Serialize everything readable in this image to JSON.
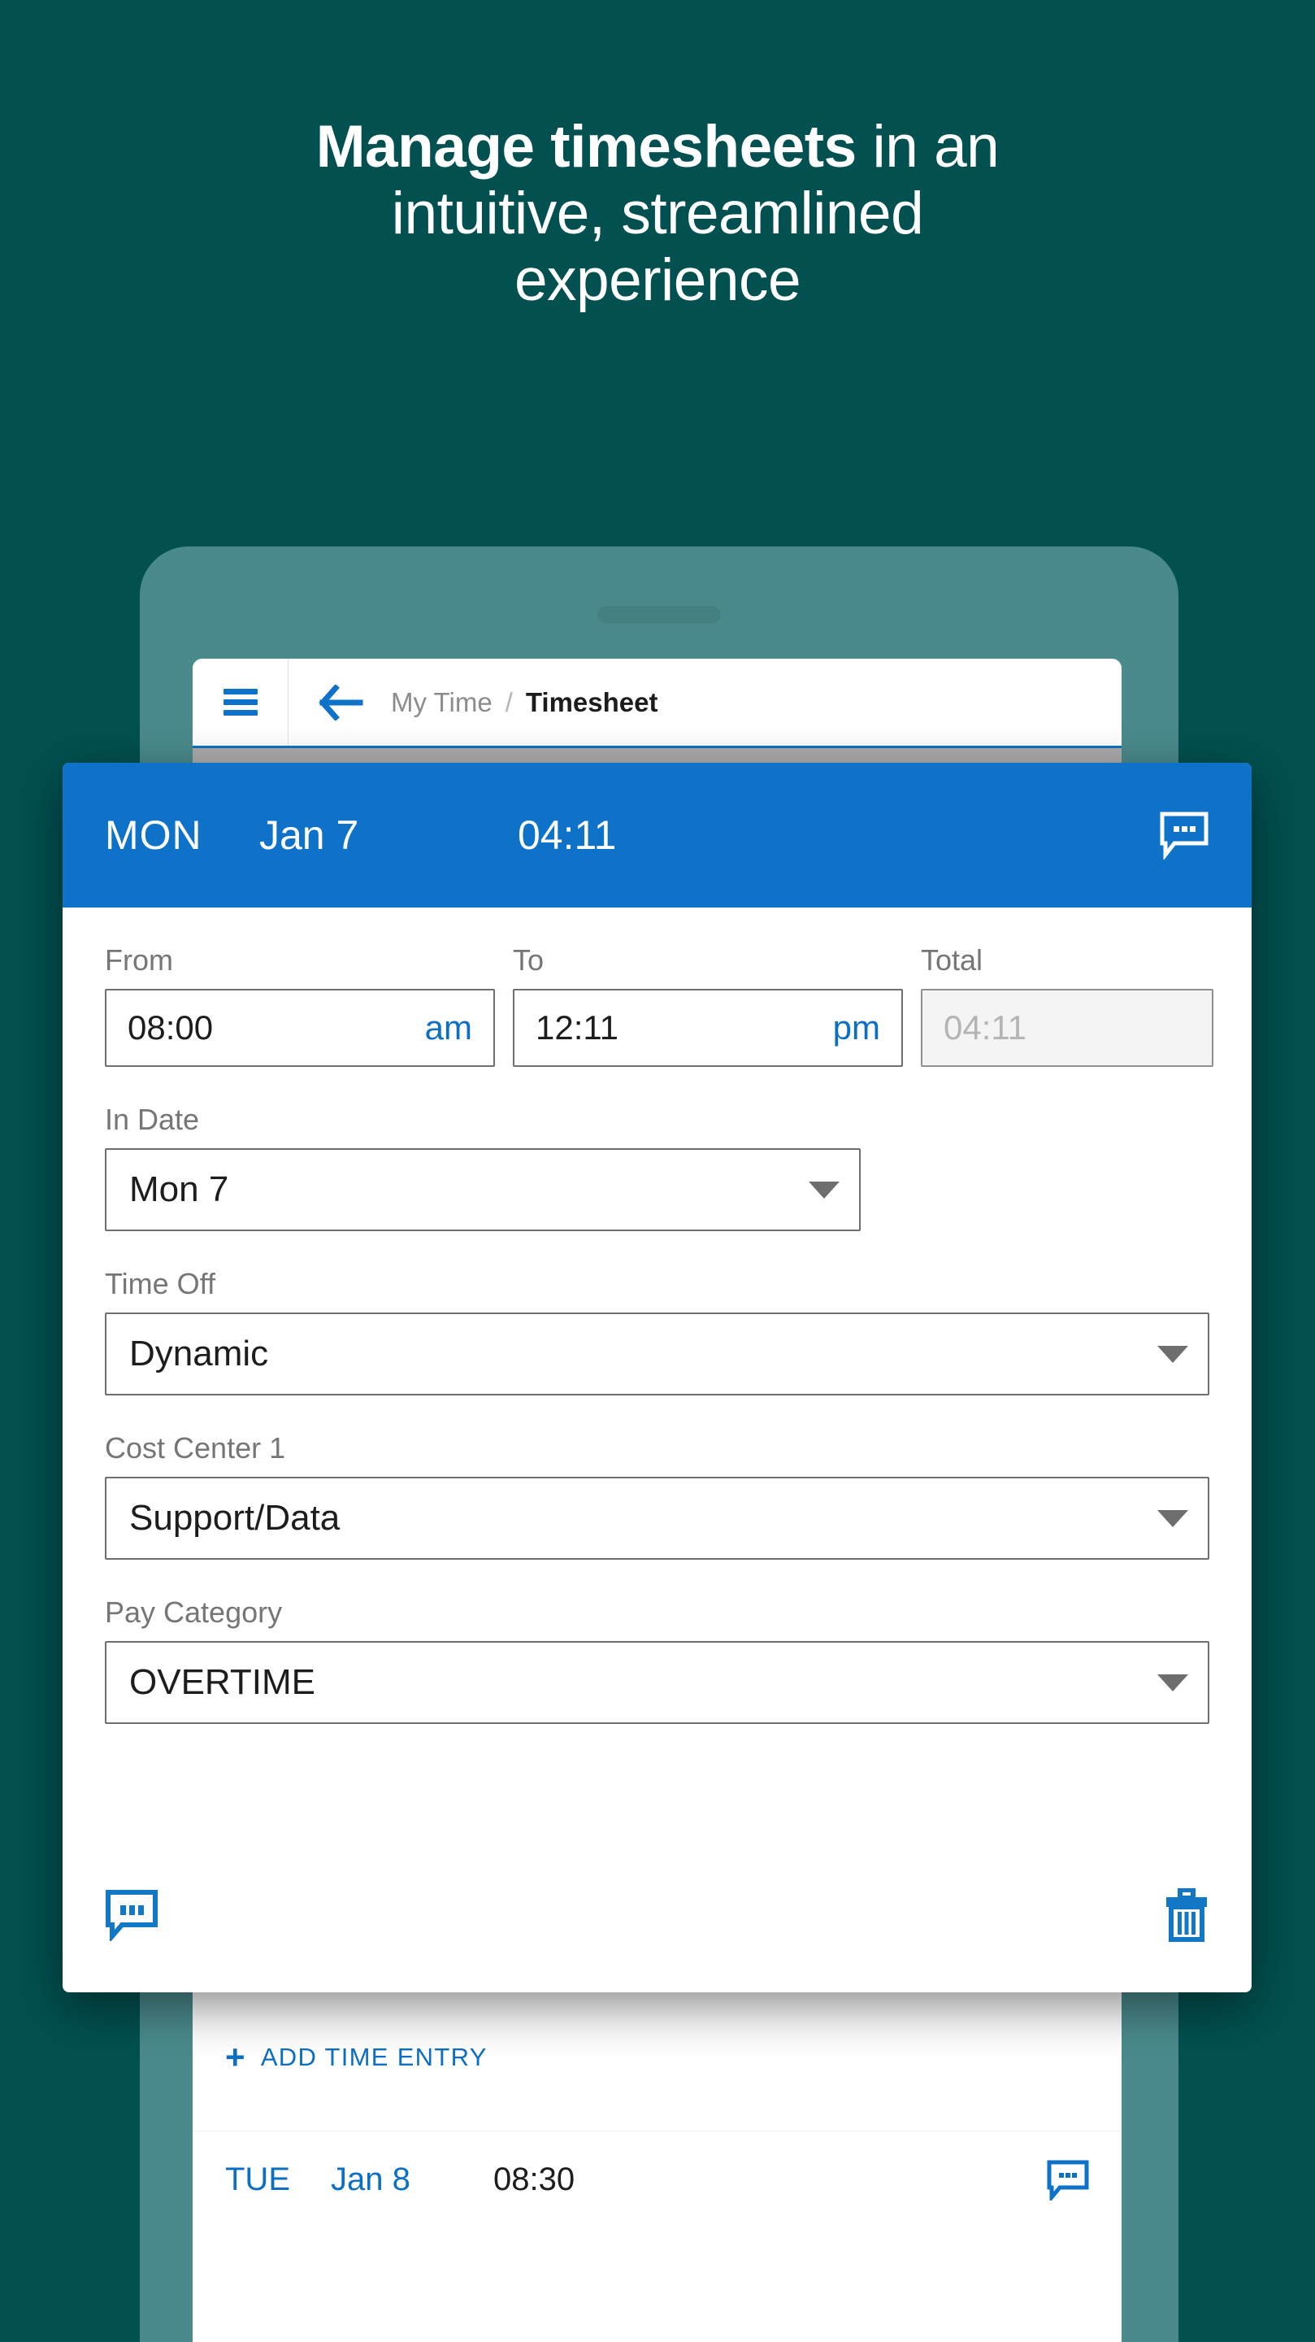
{
  "headline": {
    "bold_part": "Manage timesheets",
    "rest_line1": " in an",
    "line2": "intuitive, streamlined",
    "line3": "experience"
  },
  "colors": {
    "background": "#025050",
    "phone_frame": "#4a8a8c",
    "accent_blue": "#0d72c8",
    "link_blue": "#0d6fc2",
    "label_grey": "#767676",
    "disabled_grey": "#b4b4b4"
  },
  "appbar": {
    "menu_icon": "hamburger-menu-icon",
    "back_icon": "back-arrow-icon",
    "breadcrumb_parent": "My Time",
    "breadcrumb_separator": "/",
    "breadcrumb_current": "Timesheet"
  },
  "dialog": {
    "header": {
      "day": "MON",
      "date": "Jan 7",
      "time": "04:11",
      "comment_icon": "comment-bubble-icon"
    },
    "fields": {
      "from_label": "From",
      "from_value": "08:00",
      "from_meridiem": "am",
      "to_label": "To",
      "to_value": "12:11",
      "to_meridiem": "pm",
      "total_label": "Total",
      "total_value": "04:11",
      "in_date_label": "In Date",
      "in_date_value": "Mon 7",
      "time_off_label": "Time Off",
      "time_off_value": "Dynamic",
      "cost_center_label": "Cost Center 1",
      "cost_center_value": "Support/Data",
      "pay_category_label": "Pay Category",
      "pay_category_value": "OVERTIME"
    },
    "actions": {
      "comment_icon": "comment-bubble-icon",
      "delete_icon": "trash-delete-icon"
    }
  },
  "timesheet_list": {
    "add_entry_plus": "+",
    "add_entry_label": "ADD TIME ENTRY",
    "rows": [
      {
        "day": "TUE",
        "date": "Jan 8",
        "time": "08:30",
        "comment_icon": "comment-bubble-icon"
      }
    ]
  }
}
